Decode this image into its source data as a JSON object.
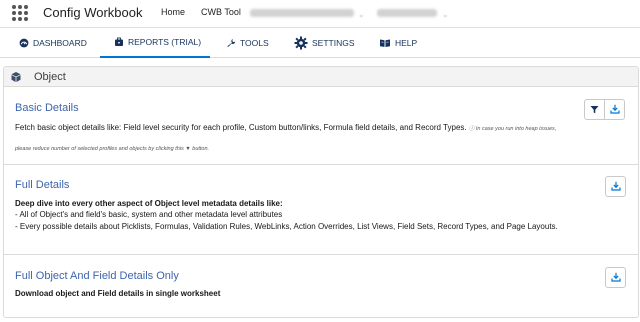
{
  "app": {
    "title": "Config Workbook"
  },
  "topnav": {
    "home": "Home",
    "cwb_tool": "CWB Tool"
  },
  "tabs": [
    {
      "label": "DASHBOARD",
      "icon": "dashboard-icon"
    },
    {
      "label": "REPORTS (TRIAL)",
      "icon": "briefcase-icon"
    },
    {
      "label": "TOOLS",
      "icon": "wrench-icon"
    },
    {
      "label": "SETTINGS",
      "icon": "gear-icon"
    },
    {
      "label": "HELP",
      "icon": "help-book-icon"
    }
  ],
  "active_tab": "REPORTS (TRIAL)",
  "object_panel": {
    "title": "Object",
    "icon": "cube-icon"
  },
  "sections": {
    "basic": {
      "title": "Basic Details",
      "description": "Fetch basic object details like: Field level security for each profile, Custom button/links, Formula field details, and Record Types.",
      "note_line1": "ⓘ In case you run into heap issues,",
      "note_line2": "please reduce number of selected profiles and objects by clicking this ▼ button."
    },
    "full": {
      "title": "Full Details",
      "intro": "Deep dive into every other aspect of Object level metadata details like:",
      "bullet1": "- All of Object's and field's basic, system and other metadata level attributes",
      "bullet2": "- Every possible details about Picklists, Formulas, Validation Rules, WebLinks, Action Overrides, List Views, Field Sets, Record Types, and Page Layouts."
    },
    "object_field": {
      "title": "Full Object And Field Details Only",
      "description": "Download object and Field details in single worksheet"
    }
  },
  "colors": {
    "accent": "#0176d3",
    "section_title": "#3e65ae",
    "nav_text": "#16325c"
  }
}
